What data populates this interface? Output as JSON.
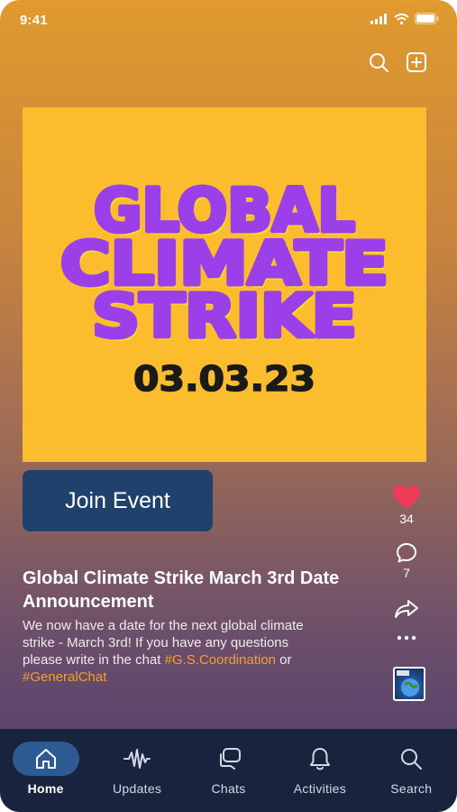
{
  "status_bar": {
    "time": "9:41"
  },
  "top_actions": {
    "search_icon": "search-icon",
    "add_icon": "plus-square-icon"
  },
  "poster": {
    "line1": "GLOBAL",
    "line2": "CLIMATE",
    "line3": "STRIKE",
    "date": "03.03.23",
    "bg_color": "#fbbd2e",
    "text_color": "#9b3fe8"
  },
  "join_button": {
    "label": "Join Event",
    "color": "#1f416b"
  },
  "side_actions": {
    "likes": "34",
    "comments": "7",
    "like_icon": "heart-icon",
    "comment_icon": "comment-icon",
    "share_icon": "share-icon",
    "more_icon": "more-dots-icon"
  },
  "post": {
    "title": "Global Climate Strike March 3rd Date Announcement",
    "body_text": "We now have a date for the next global climate strike - March 3rd! If you have any questions please write in the chat",
    "hashtag1": "#G.S.Coordination",
    "connector": "or",
    "hashtag2": "#GeneralChat",
    "hashtag_color": "#f2a22a"
  },
  "tabs": [
    {
      "label": "Home",
      "icon": "home-icon",
      "active": true
    },
    {
      "label": "Updates",
      "icon": "waveform-icon",
      "active": false
    },
    {
      "label": "Chats",
      "icon": "chat-bubbles-icon",
      "active": false
    },
    {
      "label": "Activities",
      "icon": "bell-icon",
      "active": false
    },
    {
      "label": "Search",
      "icon": "search-icon",
      "active": false
    }
  ]
}
